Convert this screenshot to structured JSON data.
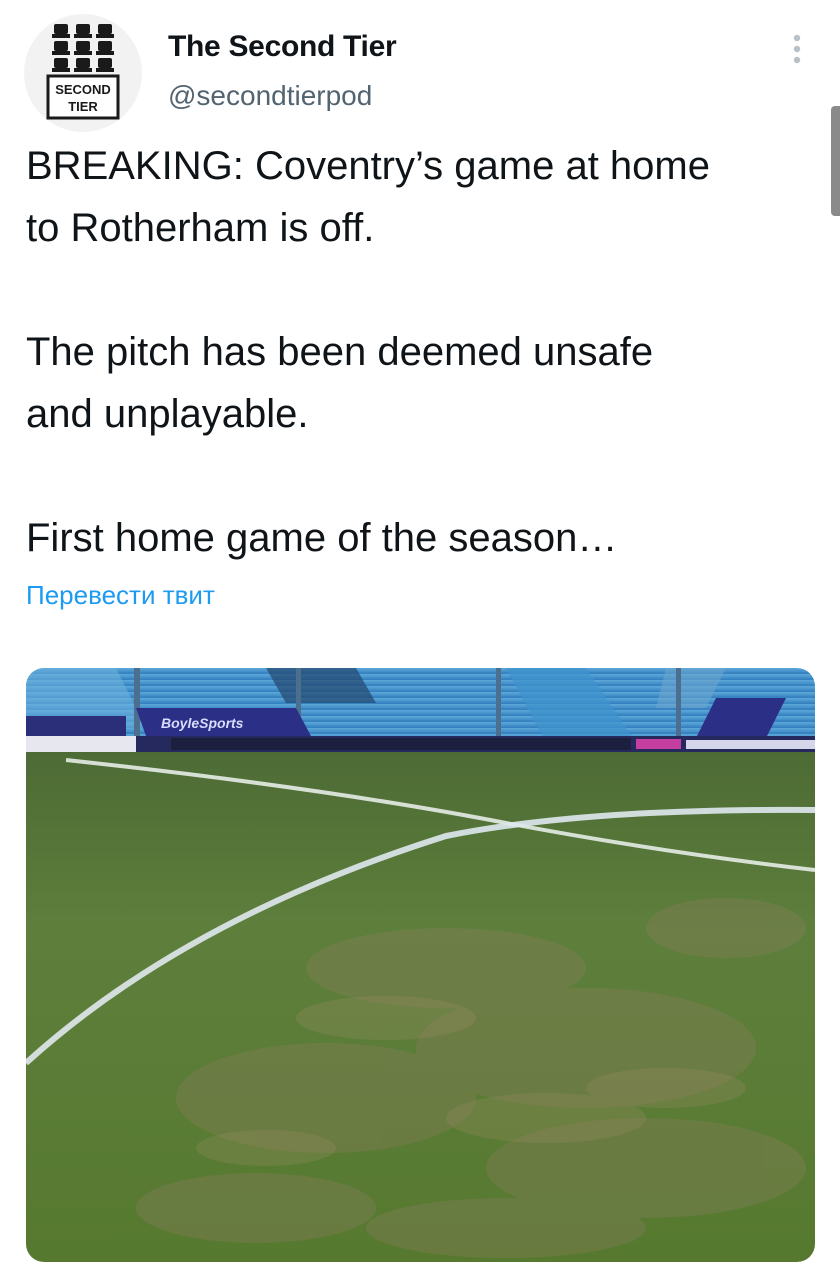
{
  "author": {
    "name": "The Second Tier",
    "handle": "@secondtierpod",
    "avatar_text": [
      "SECOND",
      "TIER"
    ],
    "avatar_icon": "stadium-seats-logo"
  },
  "tweet": {
    "paragraphs": [
      "BREAKING: Coventry’s game at home\nto Rotherham is off.",
      "The pitch has been deemed unsafe\nand unplayable.",
      "First home game of the season…"
    ],
    "translate_label": "Перевести твит"
  },
  "media": {
    "description": "photo-stadium-pitch",
    "board_text": "BoyleSports"
  },
  "icons": {
    "more": "more-vertical-icon"
  },
  "colors": {
    "text": "#0f1419",
    "secondary": "#536471",
    "link": "#1d9bf0"
  }
}
